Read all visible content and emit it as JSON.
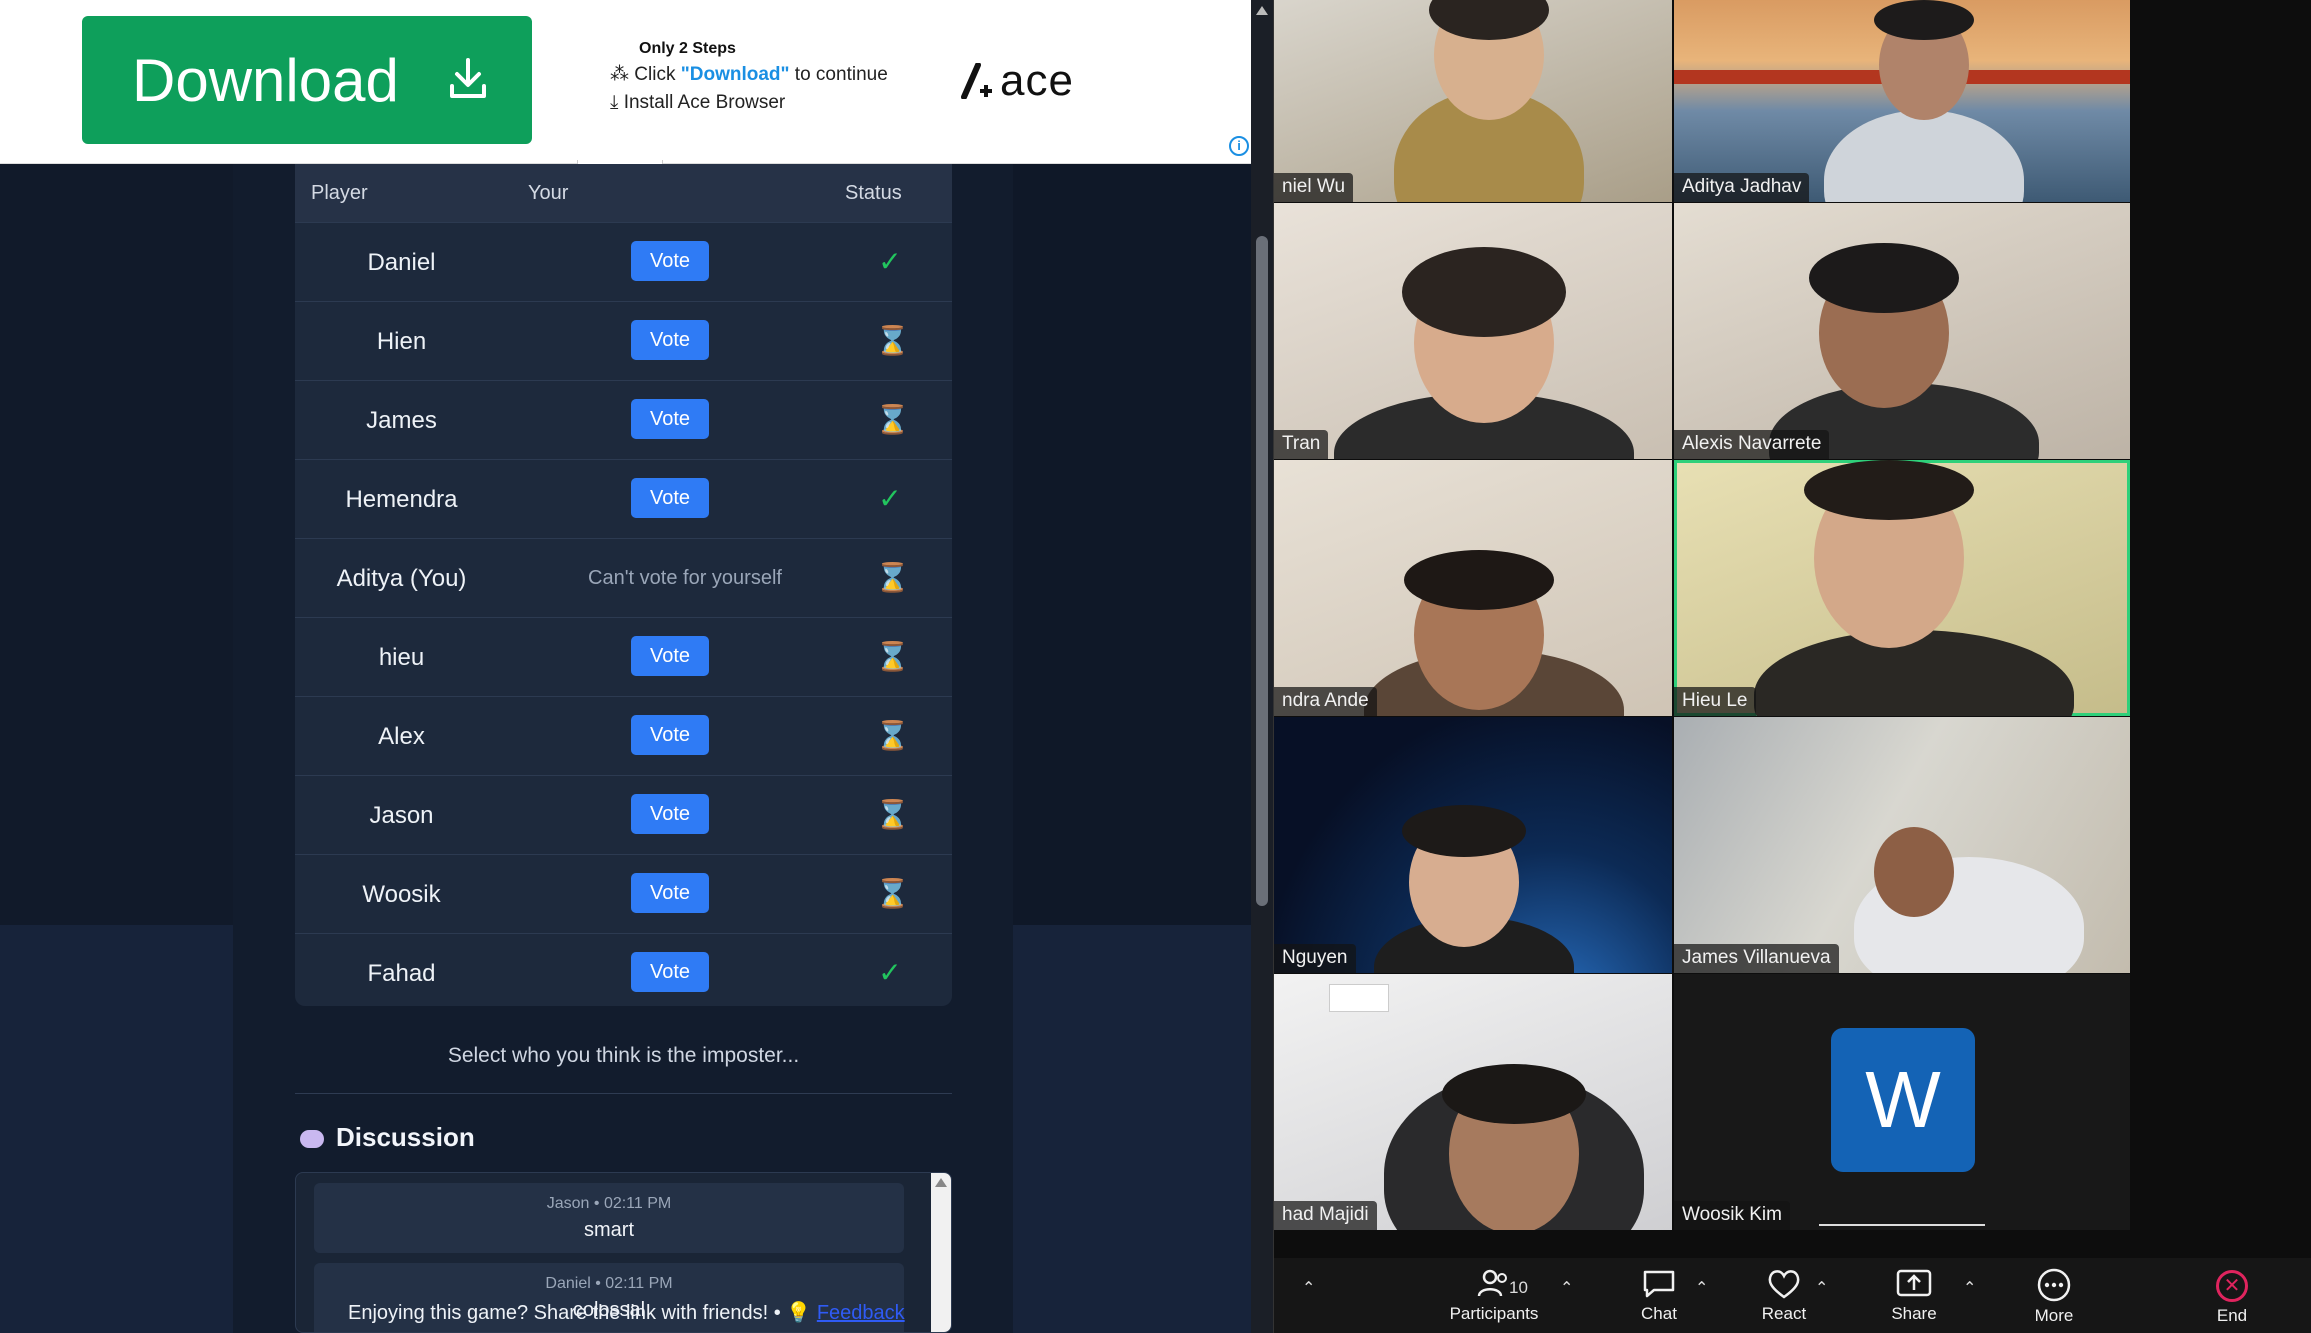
{
  "ad": {
    "download_label": "Download",
    "steps_title": "Only 2 Steps",
    "step1_prefix": "Click ",
    "step1_highlight": "\"Download\"",
    "step1_suffix": " to continue",
    "step2": "Install Ace Browser",
    "brand": "ace",
    "info": "i"
  },
  "vote": {
    "headers": {
      "player": "Player",
      "your": "Your",
      "status": "Status"
    },
    "rows": [
      {
        "player": "Daniel",
        "action": "Vote",
        "status": "✓",
        "status_kind": "voted"
      },
      {
        "player": "Hien",
        "action": "Vote",
        "status": "⌛",
        "status_kind": "waiting"
      },
      {
        "player": "James",
        "action": "Vote",
        "status": "⌛",
        "status_kind": "waiting"
      },
      {
        "player": "Hemendra",
        "action": "Vote",
        "status": "✓",
        "status_kind": "voted"
      },
      {
        "player": "Aditya (You)",
        "action": "Can't vote for yourself",
        "status": "⌛",
        "status_kind": "waiting"
      },
      {
        "player": "hieu",
        "action": "Vote",
        "status": "⌛",
        "status_kind": "waiting"
      },
      {
        "player": "Alex",
        "action": "Vote",
        "status": "⌛",
        "status_kind": "waiting"
      },
      {
        "player": "Jason",
        "action": "Vote",
        "status": "⌛",
        "status_kind": "waiting"
      },
      {
        "player": "Woosik",
        "action": "Vote",
        "status": "⌛",
        "status_kind": "waiting"
      },
      {
        "player": "Fahad",
        "action": "Vote",
        "status": "✓",
        "status_kind": "voted"
      }
    ],
    "hint": "Select who you think is the imposter..."
  },
  "discussion": {
    "title": "Discussion",
    "messages": [
      {
        "meta": "Jason • 02:11 PM",
        "text": "smart"
      },
      {
        "meta": "Daniel • 02:11 PM",
        "text": "colossal"
      }
    ],
    "share_text": "Enjoying this game? Share the link with friends!  •  💡",
    "feedback": "Feedback"
  },
  "call": {
    "participants": [
      "niel Wu",
      "Aditya Jadhav",
      "Tran",
      "Alexis Navarrete",
      "ndra Ande",
      "Hieu Le",
      "Nguyen",
      "James Villanueva",
      "had Majidi",
      "Woosik Kim"
    ],
    "woosik_initial": "W",
    "toolbar": {
      "participants_label": "Participants",
      "participants_count": "10",
      "chat_label": "Chat",
      "react_label": "React",
      "share_label": "Share",
      "more_label": "More",
      "end_label": "End"
    }
  }
}
